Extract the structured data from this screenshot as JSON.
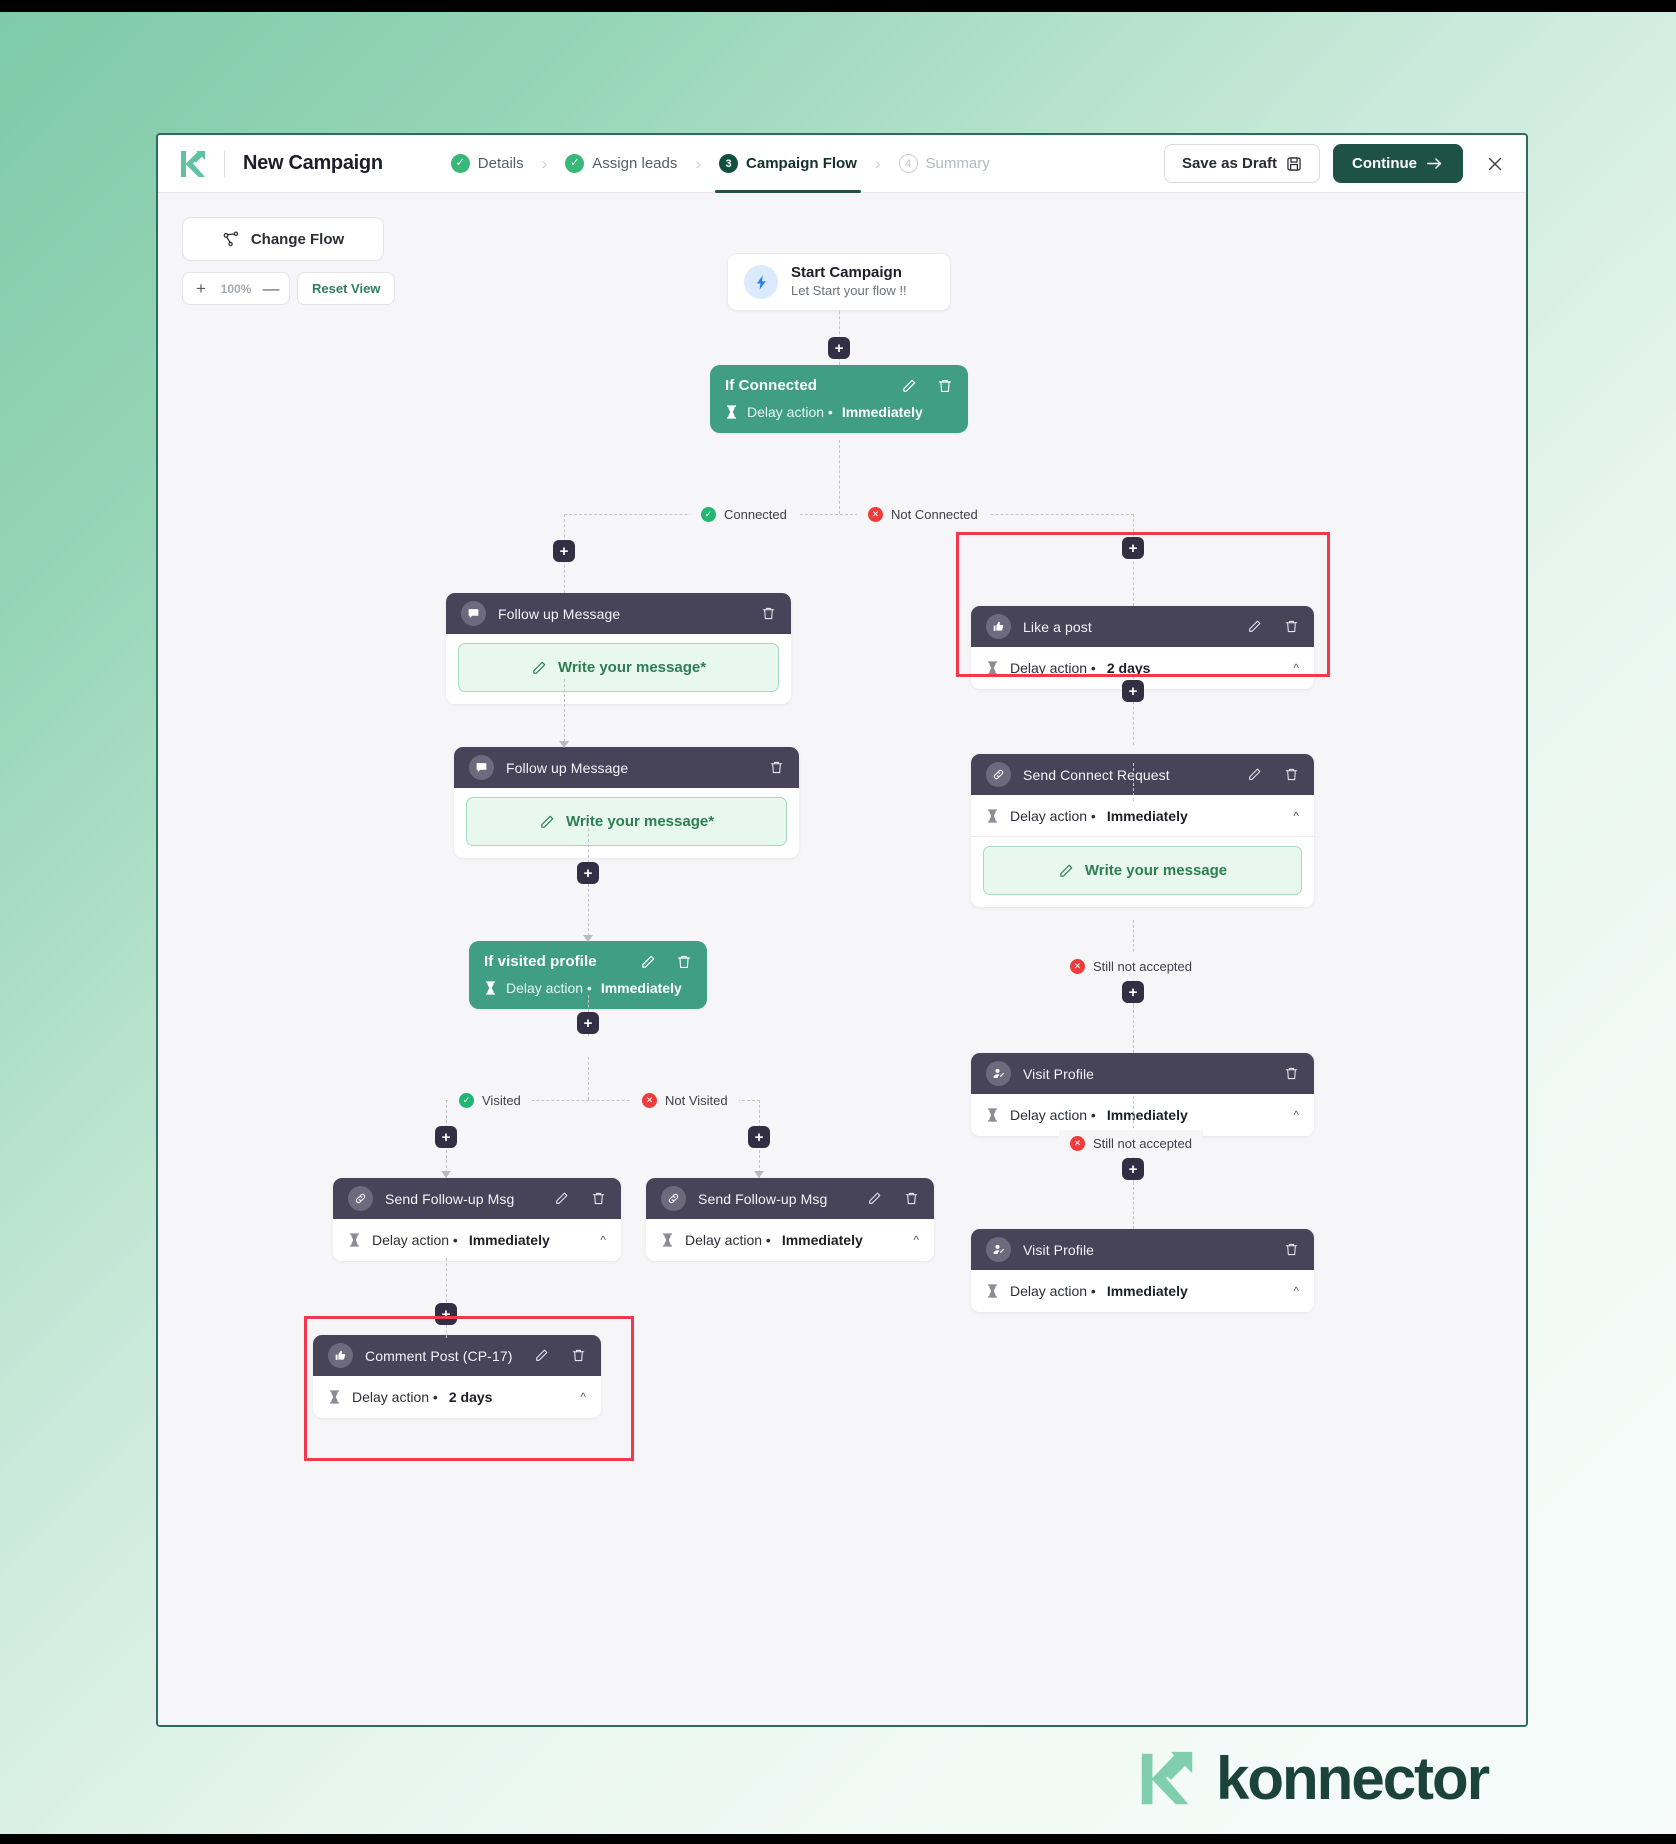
{
  "header": {
    "logo_icon": "konnector-k-logo-icon",
    "title": "New Campaign",
    "steps": [
      {
        "id": "details",
        "label": "Details",
        "state": "done",
        "marker": "check"
      },
      {
        "id": "leads",
        "label": "Assign leads",
        "state": "done",
        "marker": "check"
      },
      {
        "id": "flow",
        "label": "Campaign Flow",
        "state": "active",
        "marker": "3"
      },
      {
        "id": "summary",
        "label": "Summary",
        "state": "upcoming",
        "marker": "4"
      }
    ],
    "save_draft_label": "Save as Draft",
    "save_draft_icon": "floppy-disk-icon",
    "continue_label": "Continue",
    "continue_icon": "arrow-right-icon",
    "close_icon": "close-icon"
  },
  "toolbar": {
    "change_flow_label": "Change Flow",
    "change_flow_icon": "flow-tree-icon",
    "zoom_in_label": "+",
    "zoom_out_label": "—",
    "zoom_value": "100%",
    "reset_label": "Reset View"
  },
  "flow": {
    "start": {
      "icon": "lightning-bolt-icon",
      "title": "Start Campaign",
      "subtitle": "Let Start your flow !!"
    },
    "if_connected": {
      "title": "If Connected",
      "delay_prefix": "Delay action • ",
      "delay_value": "Immediately",
      "edit_icon": "pencil-icon",
      "delete_icon": "trash-icon",
      "hourglass_icon": "hourglass-icon"
    },
    "branch_connected": "Connected",
    "branch_not_connected": "Not Connected",
    "follow_up_1": {
      "icon": "chat-bubble-icon",
      "title": "Follow up Message",
      "delete_icon": "trash-icon",
      "write_label": "Write your message*",
      "write_icon": "pencil-icon"
    },
    "follow_up_2": {
      "icon": "chat-bubble-icon",
      "title": "Follow up Message",
      "delete_icon": "trash-icon",
      "write_label": "Write your message*",
      "write_icon": "pencil-icon"
    },
    "if_visited": {
      "title": "If visited profile",
      "delay_prefix": "Delay action • ",
      "delay_value": "Immediately",
      "edit_icon": "pencil-icon",
      "delete_icon": "trash-icon"
    },
    "branch_visited": "Visited",
    "branch_not_visited": "Not Visited",
    "send_followup_left": {
      "icon": "link-icon",
      "title": "Send Follow-up Msg",
      "delay_prefix": "Delay action • ",
      "delay_value": "Immediately"
    },
    "send_followup_right": {
      "icon": "link-icon",
      "title": "Send Follow-up Msg",
      "delay_prefix": "Delay action • ",
      "delay_value": "Immediately"
    },
    "comment_post": {
      "icon": "thumbs-up-icon",
      "title": "Comment Post (CP-17)",
      "delay_prefix": "Delay action • ",
      "delay_value": "2 days"
    },
    "like_a_post": {
      "icon": "thumbs-up-icon",
      "title": "Like a post",
      "delay_prefix": "Delay action • ",
      "delay_value": "2 days"
    },
    "send_connect_request": {
      "icon": "link-icon",
      "title": "Send Connect Request",
      "delay_prefix": "Delay action • ",
      "delay_value": "Immediately",
      "write_label": "Write your message",
      "write_icon": "pencil-icon"
    },
    "still_not_accepted_1": "Still not accepted",
    "visit_profile_1": {
      "icon": "visit-profile-icon",
      "title": "Visit Profile",
      "delay_prefix": "Delay action • ",
      "delay_value": "Immediately"
    },
    "still_not_accepted_2": "Still not accepted",
    "visit_profile_2": {
      "icon": "visit-profile-icon",
      "title": "Visit Profile",
      "delay_prefix": "Delay action • ",
      "delay_value": "Immediately"
    },
    "plus_label": "+"
  },
  "footer": {
    "brand": "konnector",
    "logo_icon": "konnector-k-logo-icon"
  },
  "colors": {
    "brand_dark_green": "#1f5246",
    "brand_green": "#3f9e84",
    "node_dark": "#474459",
    "accent_red": "#f0384f",
    "success": "#22b573",
    "error": "#ef3b3b"
  }
}
